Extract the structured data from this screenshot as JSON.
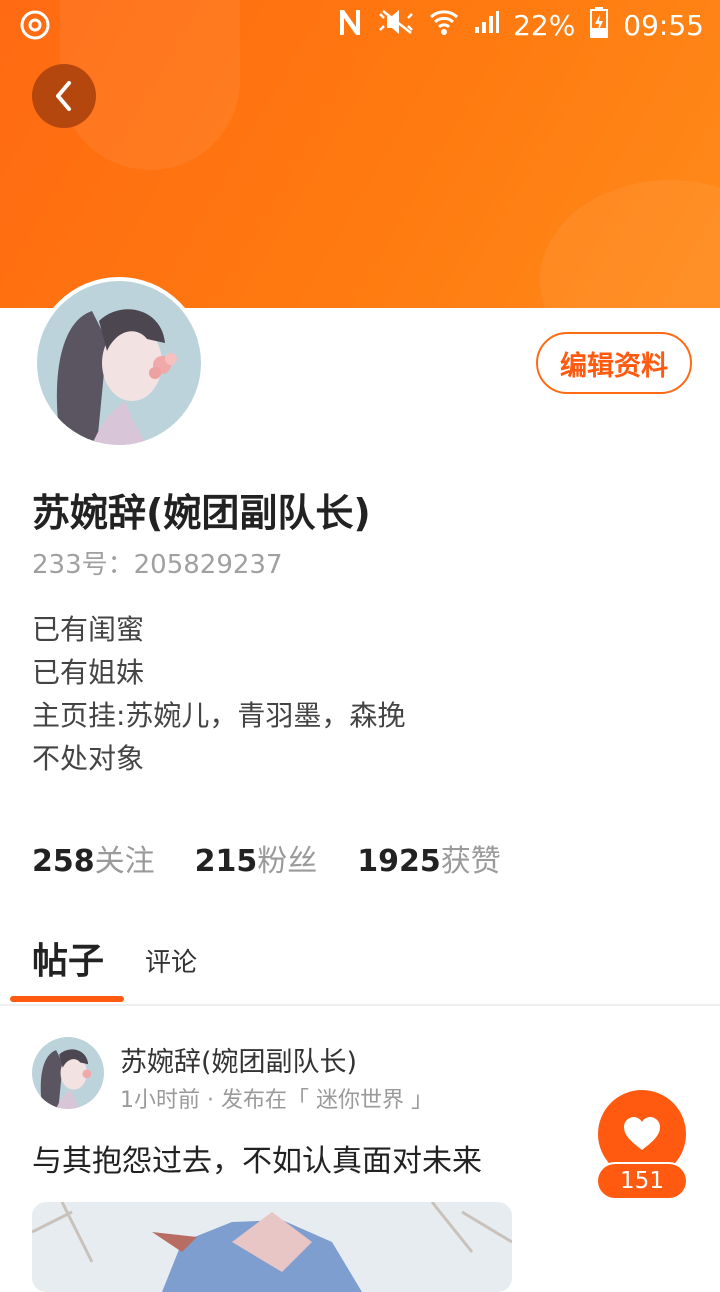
{
  "status_bar": {
    "battery": "22%",
    "time": "09:55"
  },
  "header": {
    "back_icon": "chevron-left-icon",
    "accent": "#ff6a12"
  },
  "profile": {
    "edit_label": "编辑资料",
    "nickname": "苏婉辞(婉团副队长)",
    "uid": "233号：205829237",
    "bio": [
      "已有闺蜜",
      "已有姐妹",
      "主页挂:苏婉儿，青羽墨，森挽",
      "不处对象"
    ],
    "stats": [
      {
        "num": "258",
        "label": "关注"
      },
      {
        "num": "215",
        "label": "粉丝"
      },
      {
        "num": "1925",
        "label": "获赞"
      }
    ]
  },
  "tabs": {
    "active": "帖子",
    "other": "评论"
  },
  "post": {
    "author": "苏婉辞(婉团副队长)",
    "meta": "1小时前 · 发布在「 迷你世界 」",
    "text": "与其抱怨过去，不如认真面对未来",
    "likes": "151"
  }
}
